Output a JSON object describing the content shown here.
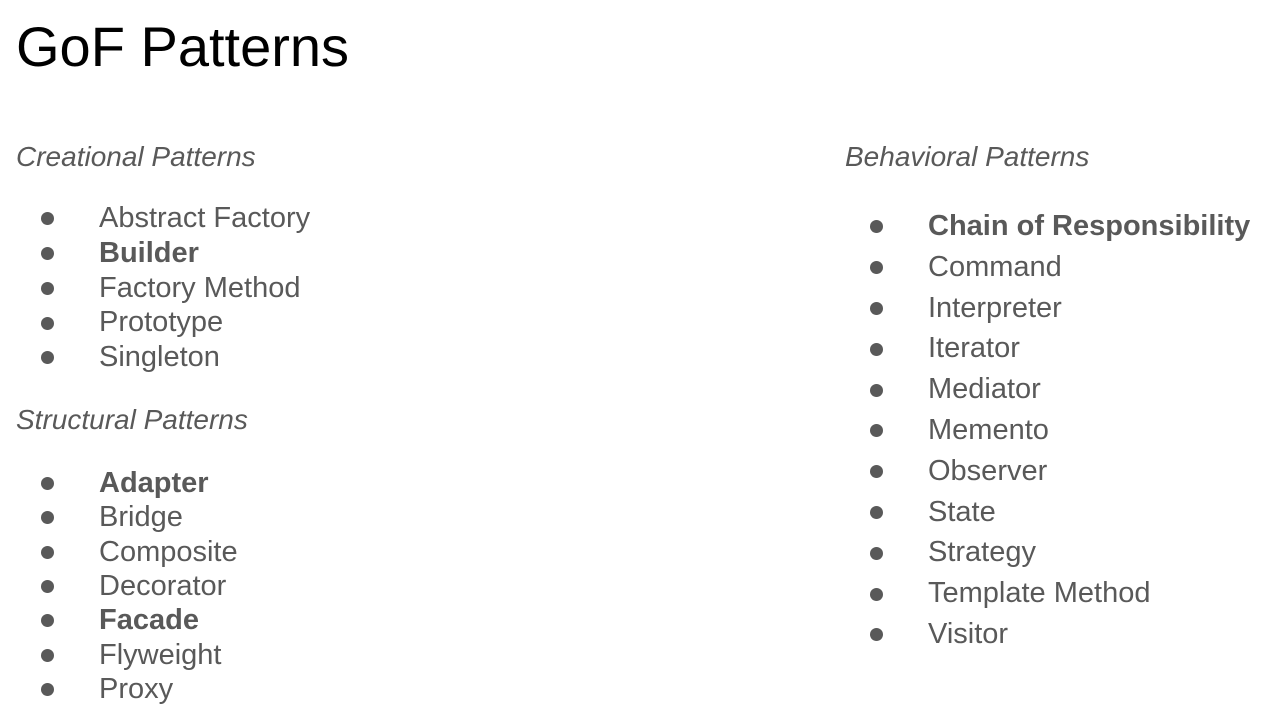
{
  "title": "GoF Patterns",
  "colors": {
    "title": "#000000",
    "body_text": "#595959",
    "background": "#ffffff"
  },
  "sections": {
    "creational": {
      "heading": "Creational Patterns",
      "items": [
        {
          "label": "Abstract Factory",
          "bold": false
        },
        {
          "label": "Builder",
          "bold": true
        },
        {
          "label": "Factory Method",
          "bold": false
        },
        {
          "label": "Prototype",
          "bold": false
        },
        {
          "label": "Singleton",
          "bold": false
        }
      ]
    },
    "structural": {
      "heading": "Structural Patterns",
      "items": [
        {
          "label": "Adapter",
          "bold": true
        },
        {
          "label": "Bridge",
          "bold": false
        },
        {
          "label": "Composite",
          "bold": false
        },
        {
          "label": "Decorator",
          "bold": false
        },
        {
          "label": "Facade",
          "bold": true
        },
        {
          "label": "Flyweight",
          "bold": false
        },
        {
          "label": "Proxy",
          "bold": false
        }
      ]
    },
    "behavioral": {
      "heading": "Behavioral Patterns",
      "items": [
        {
          "label": "Chain of Responsibility",
          "bold": true
        },
        {
          "label": "Command",
          "bold": false
        },
        {
          "label": "Interpreter",
          "bold": false
        },
        {
          "label": "Iterator",
          "bold": false
        },
        {
          "label": "Mediator",
          "bold": false
        },
        {
          "label": "Memento",
          "bold": false
        },
        {
          "label": "Observer",
          "bold": false
        },
        {
          "label": "State",
          "bold": false
        },
        {
          "label": "Strategy",
          "bold": false
        },
        {
          "label": "Template Method",
          "bold": false
        },
        {
          "label": "Visitor",
          "bold": false
        }
      ]
    }
  }
}
